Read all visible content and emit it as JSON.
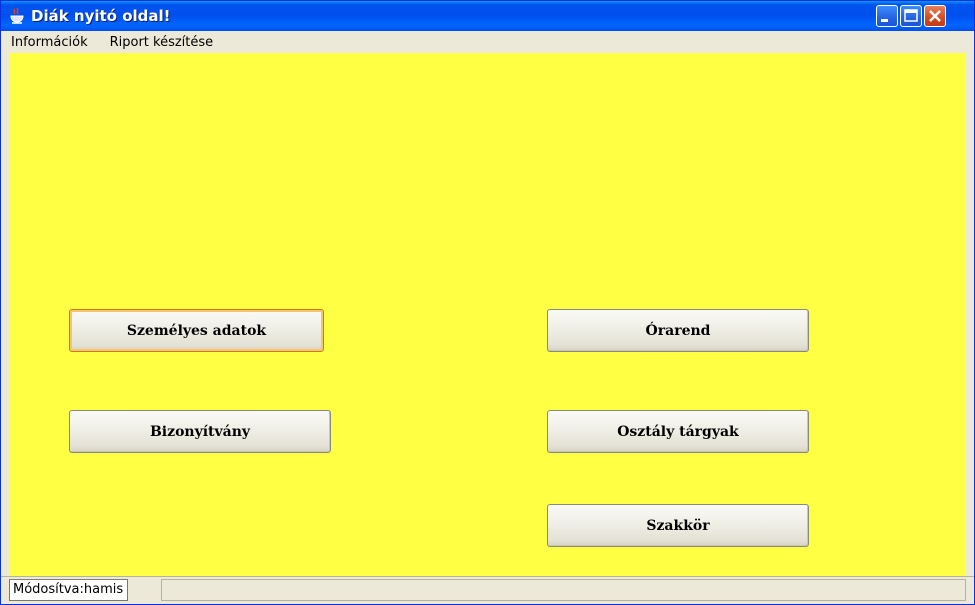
{
  "window": {
    "title": "Diák nyitó oldal!",
    "controls": [
      "minimize-icon",
      "maximize-icon",
      "close-icon"
    ]
  },
  "menubar": {
    "items": [
      {
        "label": "Információk"
      },
      {
        "label": "Riport készítése"
      }
    ]
  },
  "main": {
    "background_color": "#ffff44",
    "buttons": {
      "personal_data": "Személyes adatok",
      "timetable": "Órarend",
      "certificate": "Bizonyítvány",
      "class_subjects": "Osztály tárgyak",
      "club": "Szakkör"
    }
  },
  "statusbar": {
    "text": "Módosítva:hamis"
  }
}
